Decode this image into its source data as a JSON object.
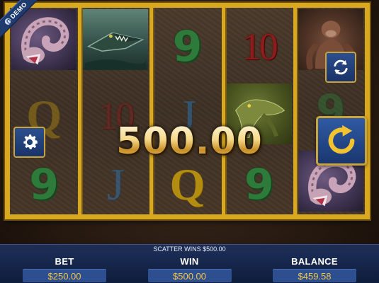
{
  "demo_label": "DEMO",
  "win_amount": "500.00",
  "scatter_message": "SCATTER WINS $500.00",
  "stats": {
    "bet": {
      "label": "BET",
      "value": "$250.00"
    },
    "win": {
      "label": "WIN",
      "value": "$500.00"
    },
    "balance": {
      "label": "BALANCE",
      "value": "$459.58"
    }
  },
  "reels": [
    [
      "snake",
      "Q",
      "9"
    ],
    [
      "crocodile",
      "10",
      "J"
    ],
    [
      "9",
      "J",
      "Q"
    ],
    [
      "10",
      "lizard",
      "9"
    ],
    [
      "ape",
      "9",
      "snake"
    ]
  ],
  "icons": {
    "settings": "gear-icon",
    "autoplay": "autoplay-icon",
    "spin": "spin-icon"
  },
  "colors": {
    "frame_gold": "#d9a821",
    "panel_blue": "#1a2c55",
    "value_gold": "#f4c542"
  }
}
